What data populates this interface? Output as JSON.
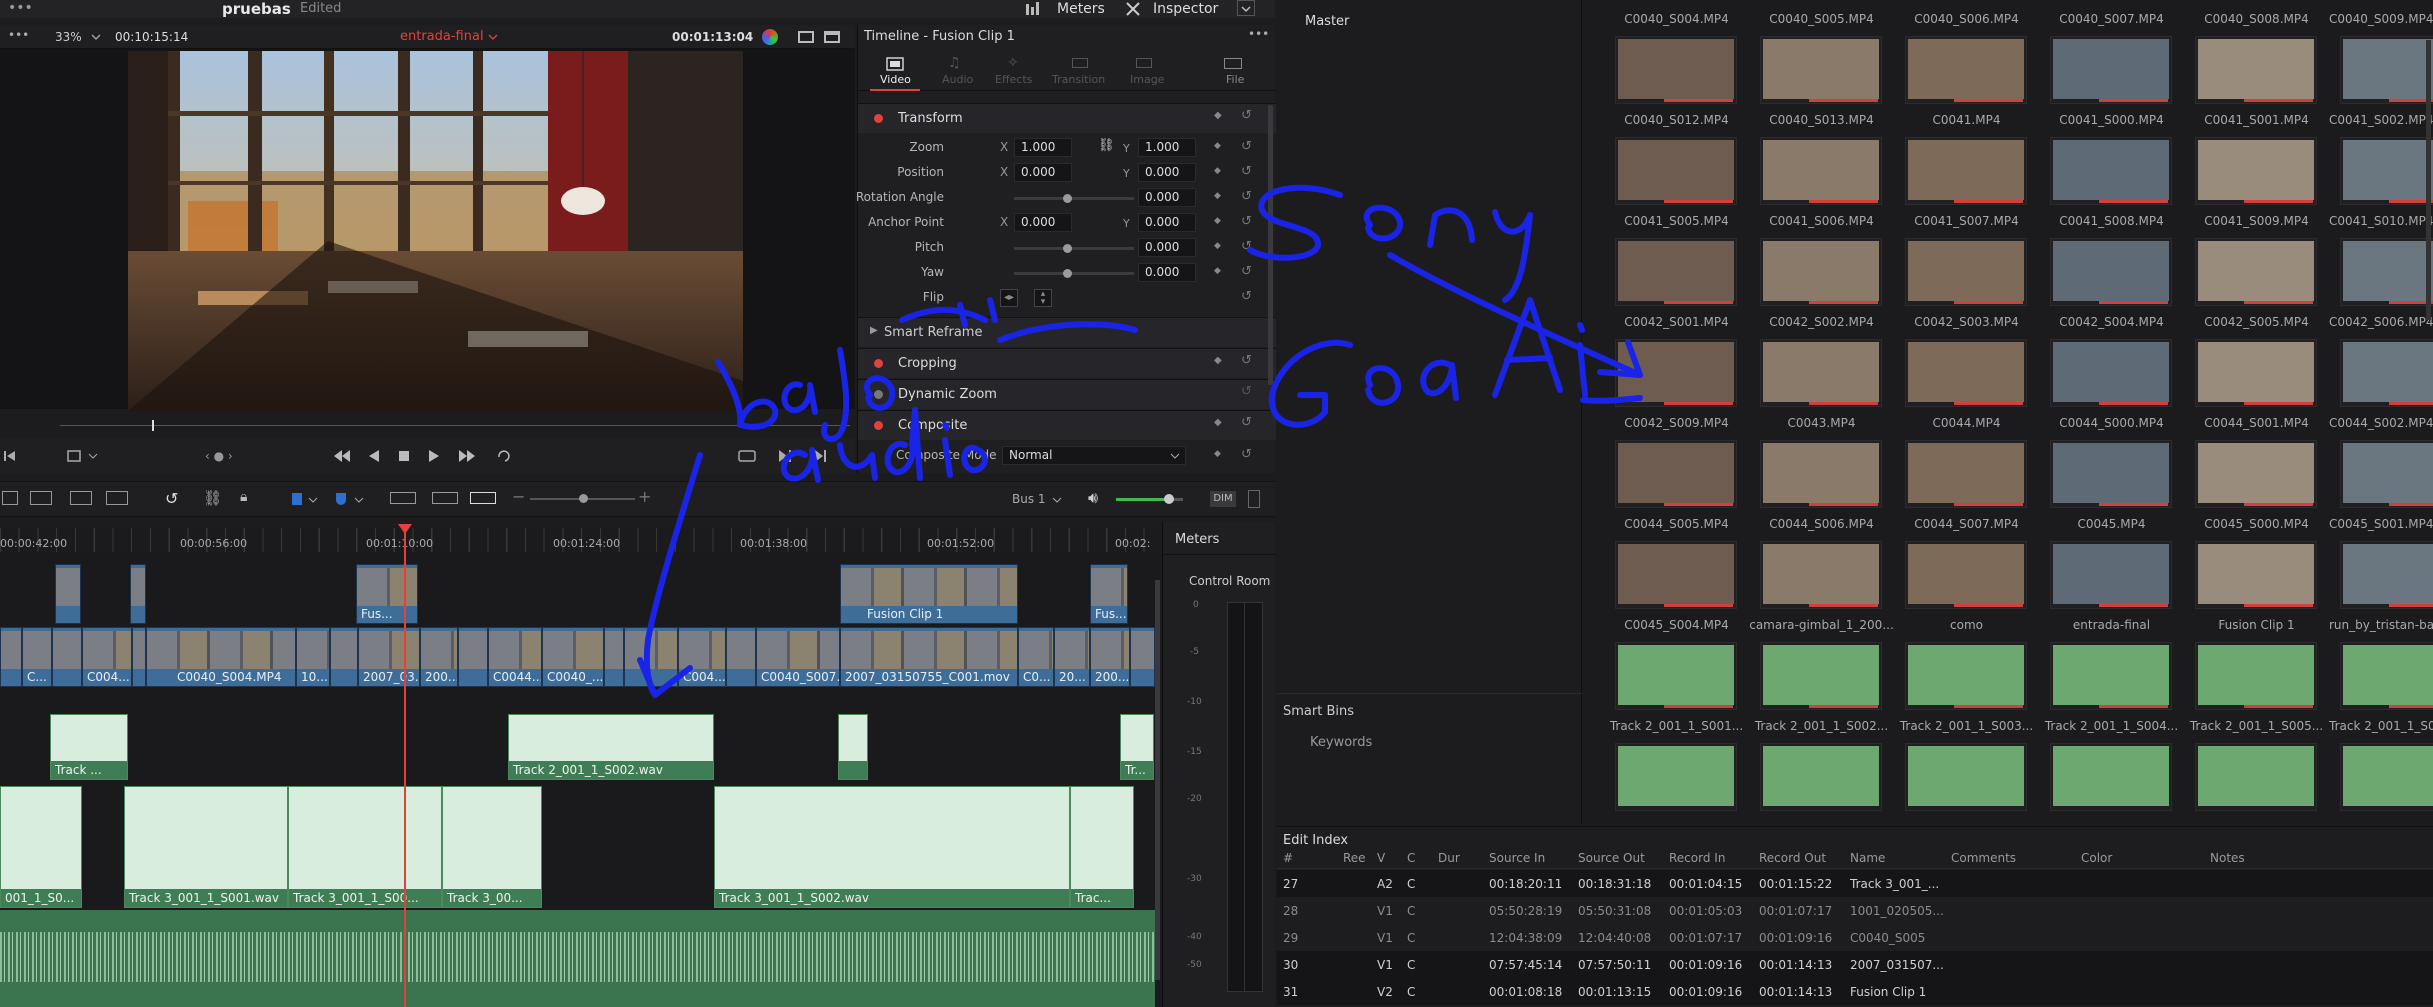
{
  "topbar": {
    "project": "pruebas",
    "status": "Edited",
    "meters_label": "Meters",
    "inspector_label": "Inspector"
  },
  "viewer": {
    "zoom": "33%",
    "timecode_left": "00:10:15:14",
    "clip_name": "entrada-final",
    "timecode_right": "00:01:13:04"
  },
  "inspector": {
    "title": "Timeline - Fusion Clip 1",
    "tabs": [
      {
        "label": "Video"
      },
      {
        "label": "Audio"
      },
      {
        "label": "Effects"
      },
      {
        "label": "Transition"
      },
      {
        "label": "Image"
      },
      {
        "label": "File"
      }
    ],
    "transform_label": "Transform",
    "zoom": {
      "label": "Zoom",
      "x": "1.000",
      "y": "1.000"
    },
    "position": {
      "label": "Position",
      "x": "0.000",
      "y": "0.000"
    },
    "rotation": {
      "label": "Rotation Angle",
      "value": "0.000"
    },
    "anchor": {
      "label": "Anchor Point",
      "x": "0.000",
      "y": "0.000"
    },
    "pitch": {
      "label": "Pitch",
      "value": "0.000"
    },
    "yaw": {
      "label": "Yaw",
      "value": "0.000"
    },
    "flip_label": "Flip",
    "x_label": "X",
    "y_label": "Y",
    "smart_reframe": "Smart Reframe",
    "cropping": "Cropping",
    "dynamic_zoom": "Dynamic Zoom",
    "composite": "Composite",
    "composite_mode_label": "Composite Mode",
    "composite_mode_value": "Normal"
  },
  "timeline": {
    "bus": "Bus 1",
    "dim": "DIM",
    "ruler": [
      "00:00:42:00",
      "00:00:56:00",
      "00:01:10:00",
      "00:01:24:00",
      "00:01:38:00",
      "00:01:52:00",
      "00:02:"
    ],
    "v2_clips": [
      {
        "label": "Fus..."
      },
      {
        "label": "Fusion Clip 1"
      },
      {
        "label": "Fus..."
      }
    ],
    "v1_clips": [
      {
        "label": "C..."
      },
      {
        "label": "C004..."
      },
      {
        "label": "C0040_S004.MP4"
      },
      {
        "label": "10..."
      },
      {
        "label": "2007_03..."
      },
      {
        "label": "200..."
      },
      {
        "label": "C0044..."
      },
      {
        "label": "C0040_..."
      },
      {
        "label": "C004..."
      },
      {
        "label": "C0040_S007..."
      },
      {
        "label": "2007_03150755_C001.mov"
      },
      {
        "label": "C0..."
      },
      {
        "label": "20..."
      },
      {
        "label": "200..."
      }
    ],
    "a1_clips": [
      {
        "label": "Track ..."
      },
      {
        "label": "Track 2_001_1_S002.wav"
      },
      {
        "label": "Tr..."
      }
    ],
    "a2_clips": [
      {
        "label": "001_1_S0..."
      },
      {
        "label": "Track 3_001_1_S001.wav"
      },
      {
        "label": "Track 3_001_1_S00..."
      },
      {
        "label": "Track 3_00..."
      },
      {
        "label": "Track 3_001_1_S002.wav"
      },
      {
        "label": "Trac..."
      }
    ]
  },
  "meters": {
    "title": "Meters",
    "control_room": "Control Room",
    "scale": [
      "0",
      "-5",
      "-10",
      "-15",
      "-20",
      "-30",
      "-40",
      "-50"
    ]
  },
  "bins": {
    "master": "Master",
    "smart_bins": "Smart Bins",
    "keywords": "Keywords"
  },
  "pool": {
    "top_row": [
      "C0040_S004.MP4",
      "C0040_S005.MP4",
      "C0040_S006.MP4",
      "C0040_S007.MP4",
      "C0040_S008.MP4",
      "C0040_S009.MP4"
    ],
    "rows": [
      [
        "C0040_S012.MP4",
        "C0040_S013.MP4",
        "C0041.MP4",
        "C0041_S000.MP4",
        "C0041_S001.MP4",
        "C0041_S002.MP4"
      ],
      [
        "C0041_S005.MP4",
        "C0041_S006.MP4",
        "C0041_S007.MP4",
        "C0041_S008.MP4",
        "C0041_S009.MP4",
        "C0041_S010.MP4"
      ],
      [
        "C0042_S001.MP4",
        "C0042_S002.MP4",
        "C0042_S003.MP4",
        "C0042_S004.MP4",
        "C0042_S005.MP4",
        "C0042_S006.MP4"
      ],
      [
        "C0042_S009.MP4",
        "C0043.MP4",
        "C0044.MP4",
        "C0044_S000.MP4",
        "C0044_S001.MP4",
        "C0044_S002.MP4"
      ],
      [
        "C0044_S005.MP4",
        "C0044_S006.MP4",
        "C0044_S007.MP4",
        "C0045.MP4",
        "C0045_S000.MP4",
        "C0045_S001.MP4"
      ],
      [
        "C0045_S004.MP4",
        "camara-gimbal_1_200...",
        "como",
        "entrada-final",
        "Fusion Clip 1",
        "run_by_tristan-bart..."
      ],
      [
        "Track 2_001_1_S001...",
        "Track 2_001_1_S002...",
        "Track 2_001_1_S003...",
        "Track 2_001_1_S004...",
        "Track 2_001_1_S005...",
        "Track 2_001_1_S006..."
      ]
    ]
  },
  "edit_index": {
    "title": "Edit Index",
    "headers": [
      "#",
      "Ree",
      "V",
      "C",
      "Dur",
      "Source In",
      "Source Out",
      "Record In",
      "Record Out",
      "Name",
      "Comments",
      "Color",
      "Notes"
    ],
    "rows": [
      {
        "num": "27",
        "track": "A2",
        "c": "C",
        "src_in": "00:18:20:11",
        "src_out": "00:18:31:18",
        "rec_in": "00:01:04:15",
        "rec_out": "00:01:15:22",
        "name": "Track 3_001_..."
      },
      {
        "num": "28",
        "track": "V1",
        "c": "C",
        "src_in": "05:50:28:19",
        "src_out": "05:50:31:08",
        "rec_in": "00:01:05:03",
        "rec_out": "00:01:07:17",
        "name": "1001_020505..."
      },
      {
        "num": "29",
        "track": "V1",
        "c": "C",
        "src_in": "12:04:38:09",
        "src_out": "12:04:40:08",
        "rec_in": "00:01:07:17",
        "rec_out": "00:01:09:16",
        "name": "C0040_S005"
      },
      {
        "num": "30",
        "track": "V1",
        "c": "C",
        "src_in": "07:57:45:14",
        "src_out": "07:57:50:11",
        "rec_in": "00:01:09:16",
        "rec_out": "00:01:14:13",
        "name": "2007_031507..."
      },
      {
        "num": "31",
        "track": "V2",
        "c": "C",
        "src_in": "00:01:08:18",
        "src_out": "00:01:13:15",
        "rec_in": "00:01:09:16",
        "rec_out": "00:01:14:13",
        "name": "Fusion Clip 1"
      }
    ]
  },
  "colors": {
    "accent_red": "#e5403a",
    "clip_blue": "#3e6d99",
    "audio_green": "#3f7d55",
    "ink_blue": "#1a24e6"
  }
}
